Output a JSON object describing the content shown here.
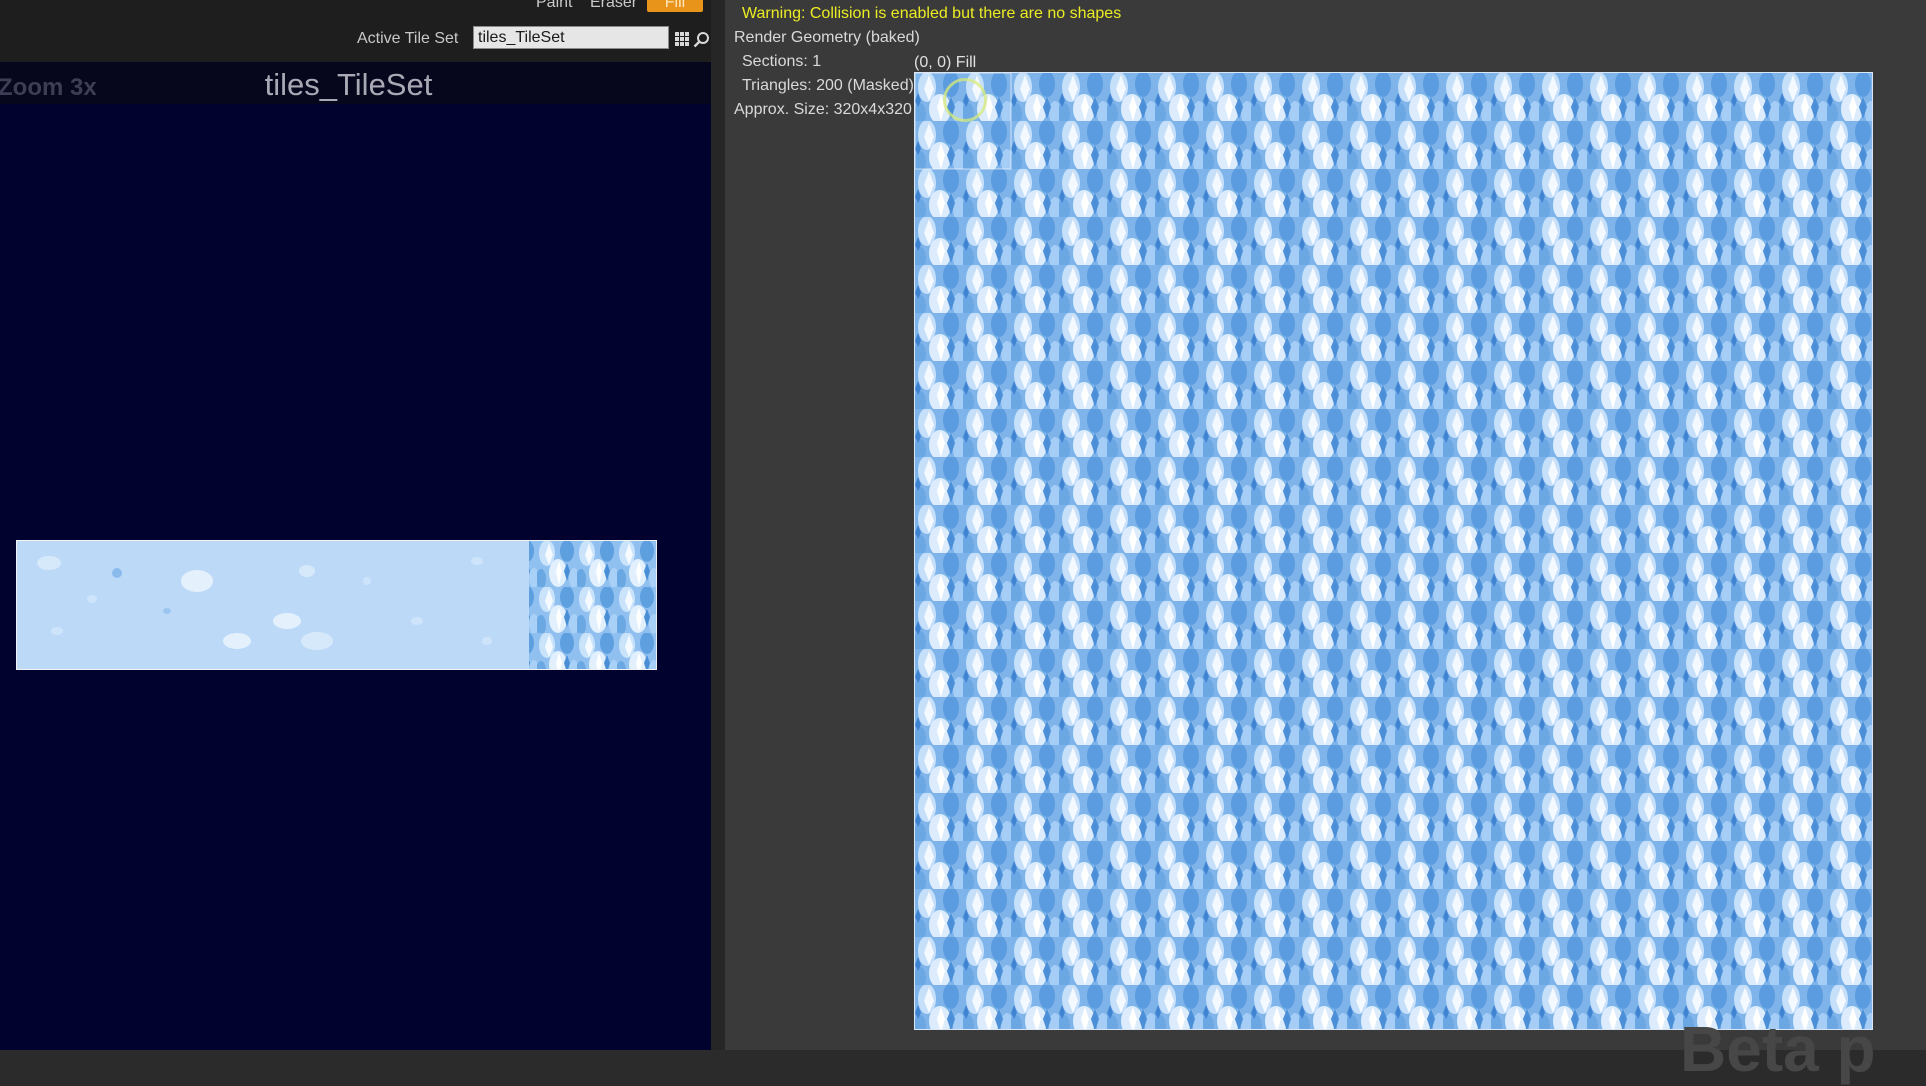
{
  "toolbar": {
    "paint_label": "Paint",
    "eraser_label": "Eraser",
    "fill_label": "Fill"
  },
  "tileset_selector": {
    "label": "Active Tile Set",
    "value": "tiles_TileSet",
    "grid_icon": "grid-icon",
    "browse_icon": "search-icon"
  },
  "tileset_viewport": {
    "zoom": "Zoom 3x",
    "title": "tiles_TileSet",
    "background_color": "#02022f"
  },
  "tilemap_viewport": {
    "stats": {
      "warning": "Warning: Collision is enabled but there are no shapes",
      "render_geometry": "Render Geometry (baked)",
      "sections": "Sections: 1",
      "triangles": "Triangles: 200 (Masked)",
      "approx_size": "Approx. Size: 320x4x320"
    },
    "tile_info": "(0, 0) Fill",
    "watermark": "Beta p",
    "warning_color": "#ecec24"
  }
}
